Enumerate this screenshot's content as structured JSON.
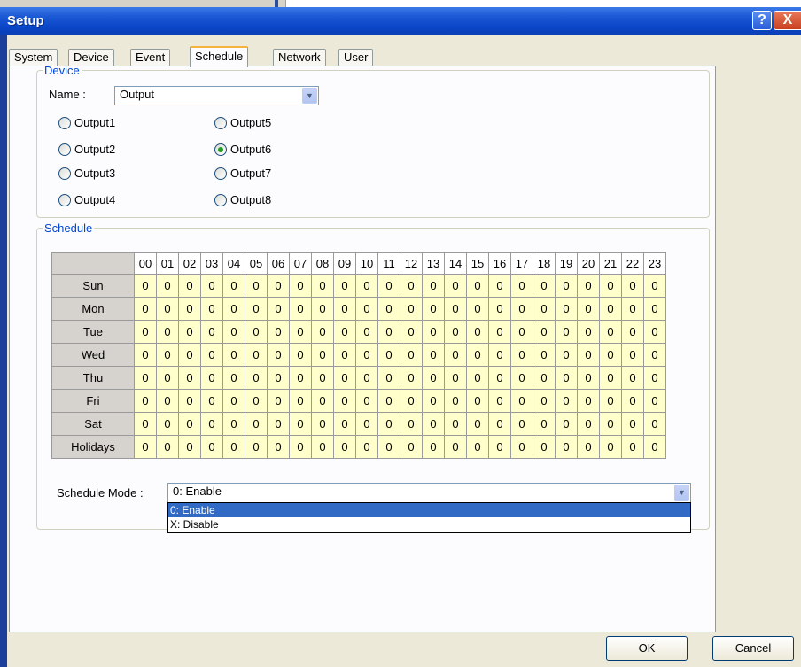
{
  "window": {
    "title": "Setup",
    "help_glyph": "?",
    "close_glyph": "X"
  },
  "tabs": [
    "System",
    "Device",
    "Event",
    "Schedule",
    "Network",
    "User"
  ],
  "active_tab": "Schedule",
  "device": {
    "legend": "Device",
    "name_label": "Name :",
    "name_value": "Output",
    "outputs": [
      {
        "label": "Output1",
        "checked": false
      },
      {
        "label": "Output2",
        "checked": false
      },
      {
        "label": "Output3",
        "checked": false
      },
      {
        "label": "Output4",
        "checked": false
      },
      {
        "label": "Output5",
        "checked": false
      },
      {
        "label": "Output6",
        "checked": true
      },
      {
        "label": "Output7",
        "checked": false
      },
      {
        "label": "Output8",
        "checked": false
      }
    ]
  },
  "schedule": {
    "legend": "Schedule",
    "hours": [
      "00",
      "01",
      "02",
      "03",
      "04",
      "05",
      "06",
      "07",
      "08",
      "09",
      "10",
      "11",
      "12",
      "13",
      "14",
      "15",
      "16",
      "17",
      "18",
      "19",
      "20",
      "21",
      "22",
      "23"
    ],
    "days": [
      "Sun",
      "Mon",
      "Tue",
      "Wed",
      "Thu",
      "Fri",
      "Sat",
      "Holidays"
    ],
    "cell_value": "0",
    "mode_label": "Schedule Mode :",
    "mode_value": "0: Enable",
    "mode_options": [
      "0: Enable",
      "X: Disable"
    ],
    "highlighted_option": "0: Enable"
  },
  "buttons": {
    "ok": "OK",
    "cancel": "Cancel"
  },
  "colors": {
    "titlebar": "#0a46c8",
    "grid_cell": "#ffffcc",
    "accent": "#0046d5",
    "selection": "#316ac5"
  }
}
